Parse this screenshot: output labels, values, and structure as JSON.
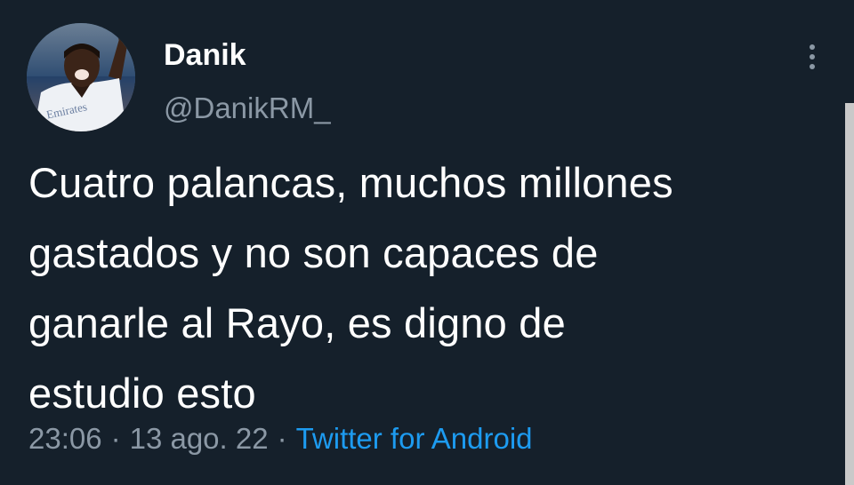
{
  "tweet": {
    "author": {
      "display_name": "Danik",
      "handle": "@DanikRM_",
      "avatar_jersey_text": "Emirates"
    },
    "text_lines": [
      "Cuatro palancas, muchos millones",
      "gastados y no son capaces de",
      "ganarle al Rayo, es digno de",
      "estudio esto"
    ],
    "time": "23:06",
    "date": "13 ago. 22",
    "source": "Twitter for Android",
    "separator": "·",
    "menu_icon": "more-vertical-icon"
  },
  "colors": {
    "background": "#15202b",
    "primary_text": "#ffffff",
    "secondary_text": "#8b98a5",
    "accent": "#1d9bf0"
  }
}
